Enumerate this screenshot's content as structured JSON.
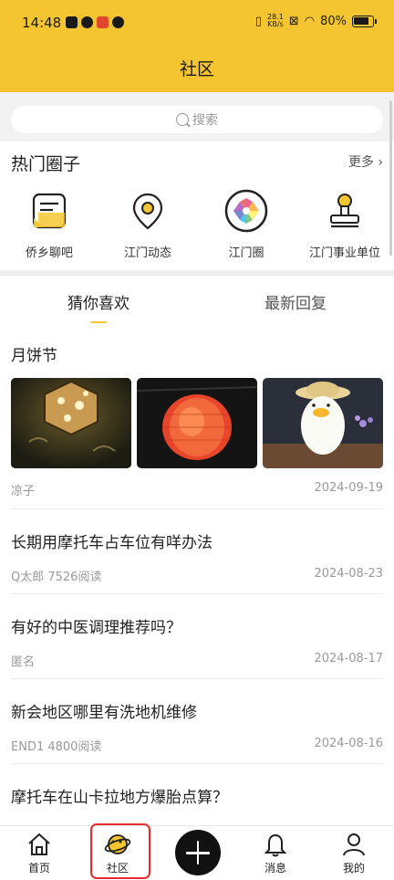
{
  "status_bar": {
    "time": "14:48",
    "net_speed": "28.1\nKB/s",
    "battery": "80%"
  },
  "header": {
    "title": "社区"
  },
  "search": {
    "placeholder": "搜索"
  },
  "hot_circles": {
    "heading": "热门圈子",
    "more_label": "更多",
    "items": [
      {
        "label": "侨乡聊吧",
        "icon": "chat-note-icon"
      },
      {
        "label": "江门动态",
        "icon": "location-pin-icon"
      },
      {
        "label": "江门圈",
        "icon": "camera-aperture-icon"
      },
      {
        "label": "江门事业单位",
        "icon": "stamp-icon"
      }
    ]
  },
  "tabs": [
    {
      "label": "猜你喜欢",
      "active": true
    },
    {
      "label": "最新回复",
      "active": false
    }
  ],
  "feed": [
    {
      "title": "月饼节",
      "author": "凉子",
      "date": "2024-09-19",
      "images": [
        "lantern-hexagon",
        "lantern-red",
        "duck-lamp"
      ]
    },
    {
      "title": "长期用摩托车占车位有咩办法",
      "author": "Q太郎 7526阅读",
      "date": "2024-08-23"
    },
    {
      "title": "有好的中医调理推荐吗？",
      "author": "匿名",
      "date": "2024-08-17"
    },
    {
      "title": "新会地区哪里有洗地机维修",
      "author": "END1   4800阅读",
      "date": "2024-08-16"
    },
    {
      "title": "摩托车在山卡拉地方爆胎点算？",
      "author": "",
      "date": ""
    }
  ],
  "bottom_nav": [
    {
      "label": "首页",
      "icon": "home-icon"
    },
    {
      "label": "社区",
      "icon": "planet-icon",
      "active": true
    },
    {
      "label": "",
      "icon": "plus-icon"
    },
    {
      "label": "消息",
      "icon": "bell-icon"
    },
    {
      "label": "我的",
      "icon": "user-icon"
    }
  ],
  "colors": {
    "brand_yellow": "#f5c531",
    "highlight_red": "#e52b2b"
  }
}
